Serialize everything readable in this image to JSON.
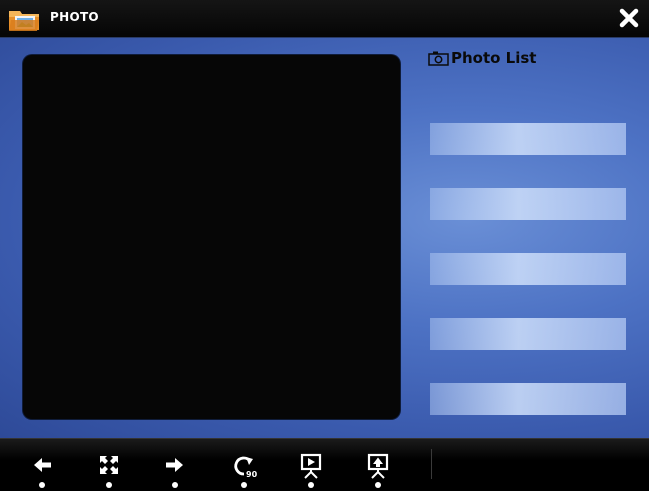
{
  "window": {
    "title": "PHOTO",
    "icons": {
      "app": "photo-folder-icon",
      "close": "close-icon"
    }
  },
  "photo_list": {
    "header": "Photo List",
    "header_icon": "camera-icon",
    "slots": 5
  },
  "toolbar": {
    "buttons": [
      {
        "icon": "arrow-left-icon",
        "action": "previous"
      },
      {
        "icon": "fullscreen-icon",
        "action": "fullscreen"
      },
      {
        "icon": "arrow-right-icon",
        "action": "next"
      },
      {
        "icon": "rotate-90-icon",
        "action": "rotate",
        "badge": "90"
      },
      {
        "icon": "slideshow-icon",
        "action": "slideshow"
      },
      {
        "icon": "set-wallpaper-icon",
        "action": "set-as-background"
      }
    ]
  },
  "colors": {
    "background_blue": "#4d72c4",
    "viewer": "#060606",
    "bars": "#000000",
    "text_light": "#ffffff",
    "text_dark": "#0a0a0a"
  }
}
